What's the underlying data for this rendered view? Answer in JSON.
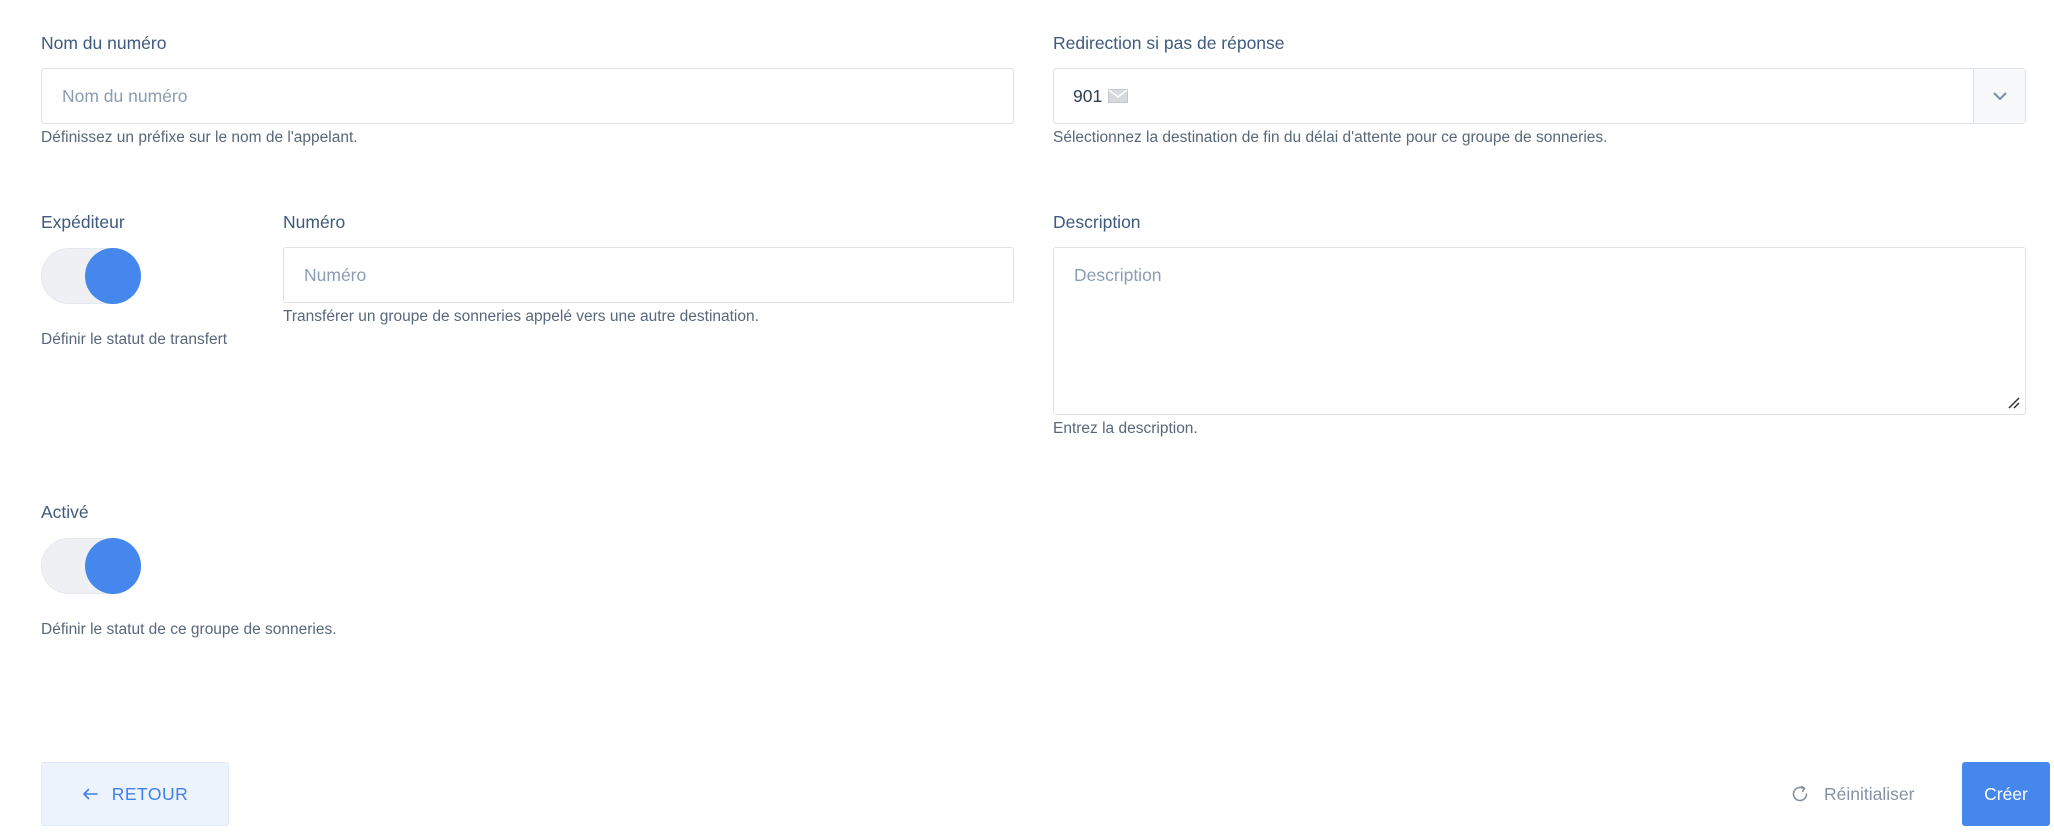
{
  "form": {
    "caller_name": {
      "label": "Nom du numéro",
      "placeholder": "Nom du numéro",
      "value": "",
      "hint": "Définissez un préfixe sur le nom de l'appelant."
    },
    "no_answer_redirect": {
      "label": "Redirection si pas de réponse",
      "value": "901",
      "value_icon": "envelope-icon",
      "hint": "Sélectionnez la destination de fin du délai d'attente pour ce groupe de sonneries."
    },
    "sender": {
      "label": "Expéditeur",
      "enabled": true,
      "hint": "Définir le statut de transfert"
    },
    "number": {
      "label": "Numéro",
      "placeholder": "Numéro",
      "value": "",
      "hint": "Transférer un groupe de sonneries appelé vers une autre destination."
    },
    "description": {
      "label": "Description",
      "placeholder": "Description",
      "value": "",
      "hint": "Entrez la description."
    },
    "active": {
      "label": "Activé",
      "enabled": true,
      "hint": "Définir le statut de ce groupe de sonneries."
    }
  },
  "actions": {
    "back_label": "RETOUR",
    "reset_label": "Réinitialiser",
    "create_label": "Créer"
  },
  "colors": {
    "accent": "#4687ee",
    "label": "#3e5a7e",
    "hint": "#58677a",
    "border": "#dfe3e8"
  }
}
